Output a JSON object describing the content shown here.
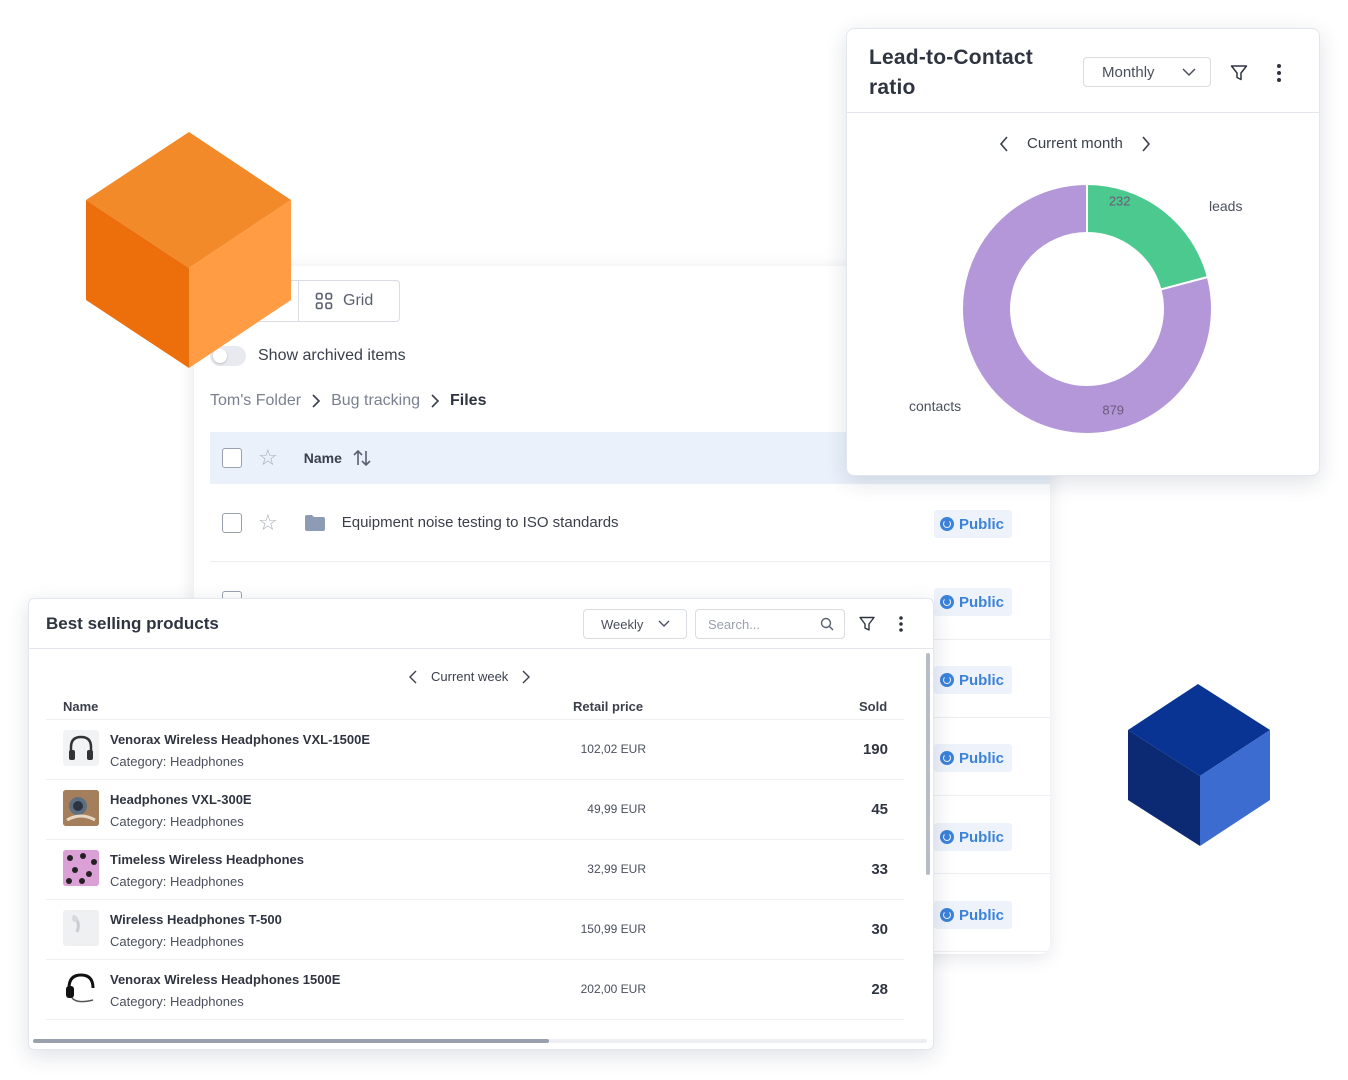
{
  "files": {
    "view_grid_label": "Grid",
    "archived_label": "Show archived items",
    "breadcrumb": [
      "Tom's Folder",
      "Bug tracking",
      "Files"
    ],
    "name_header": "Name",
    "first_row_name": "Equipment noise testing to ISO standards",
    "visibility_label": "Public",
    "visibility_rows": 6
  },
  "ratio_card": {
    "title": "Lead-to-Contact ratio",
    "period_select": "Monthly",
    "period_nav": "Current month",
    "chart_data": {
      "type": "pie",
      "donut": true,
      "slices": [
        {
          "label": "leads",
          "value": 232,
          "color": "#4cc98e"
        },
        {
          "label": "contacts",
          "value": 879,
          "color": "#b497d8"
        }
      ]
    }
  },
  "sell_card": {
    "title": "Best selling products",
    "period_select": "Weekly",
    "search_placeholder": "Search...",
    "period_nav": "Current week",
    "columns": {
      "name": "Name",
      "price": "Retail price",
      "sold": "Sold"
    },
    "rows": [
      {
        "name": "Venorax Wireless Headphones VXL-1500E",
        "category": "Category: Headphones",
        "price": "102,02 EUR",
        "sold": "190",
        "thumb": "headphones-black-icon"
      },
      {
        "name": "Headphones VXL-300E",
        "category": "Category: Headphones",
        "price": "49,99 EUR",
        "sold": "45",
        "thumb": "headphones-photo-icon"
      },
      {
        "name": "Timeless Wireless Headphones",
        "category": "Category: Headphones",
        "price": "32,99 EUR",
        "sold": "33",
        "thumb": "headphones-pink-pattern-icon"
      },
      {
        "name": "Wireless Headphones T-500",
        "category": "Category: Headphones",
        "price": "150,99 EUR",
        "sold": "30",
        "thumb": "headphones-white-icon"
      },
      {
        "name": "Venorax Wireless Headphones 1500E",
        "category": "Category: Headphones",
        "price": "202,00 EUR",
        "sold": "28",
        "thumb": "headset-icon"
      }
    ]
  },
  "colors": {
    "accent_blue": "#3b82d9",
    "cube_orange": "#f08222",
    "cube_blue": "#0a3493",
    "leads": "#4cc98e",
    "contacts": "#b497d8"
  }
}
